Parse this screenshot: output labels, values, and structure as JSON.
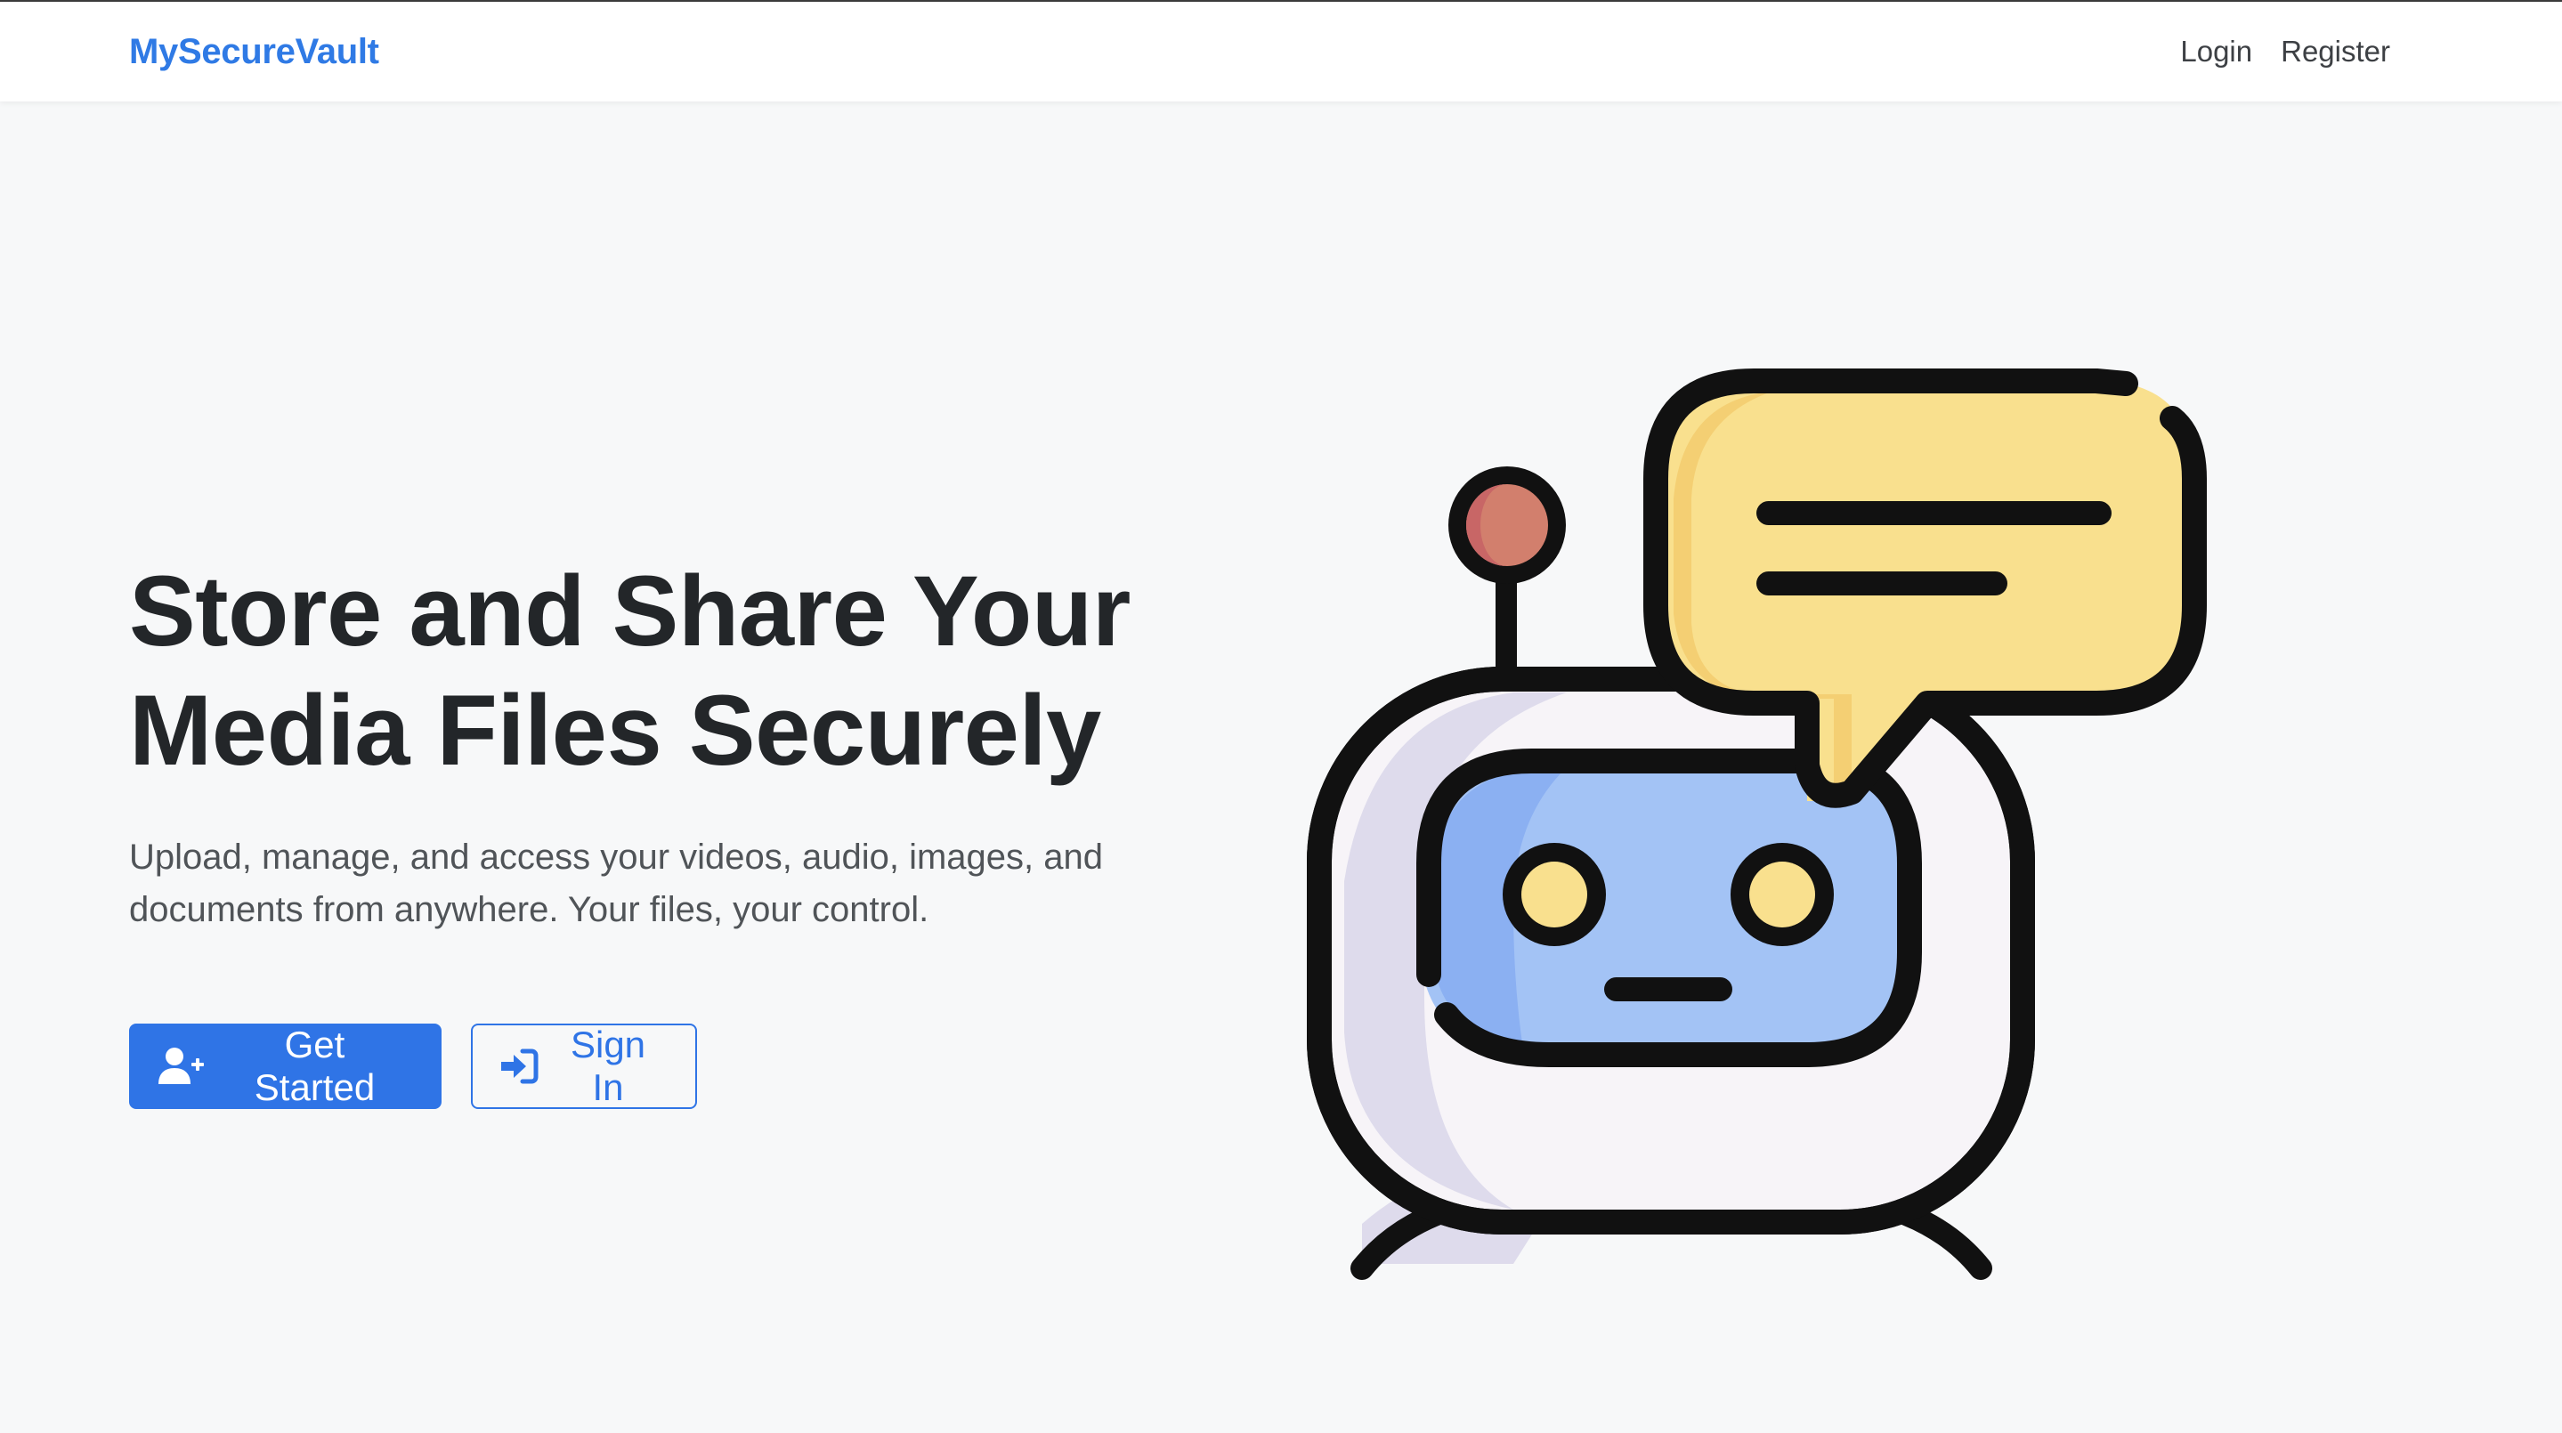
{
  "navbar": {
    "brand": "MySecureVault",
    "links": [
      {
        "label": "Login"
      },
      {
        "label": "Register"
      }
    ]
  },
  "hero": {
    "title_line1": "Store and Share Your",
    "title_line2": "Media Files Securely",
    "subtitle_line1": "Upload, manage, and access your videos, audio, images, and",
    "subtitle_line2": "documents from anywhere. Your files, your control.",
    "primary_button": {
      "label": "Get Started",
      "icon": "user-plus-icon"
    },
    "secondary_button": {
      "label": "Sign In",
      "icon": "sign-in-icon"
    }
  },
  "illustration": {
    "icon": "robot-chat-illustration"
  },
  "colors": {
    "brand": "#2f7ae5",
    "primary": "#2f74e6",
    "background": "#f7f8f9",
    "robot_face": "#a3c3f5",
    "speech_bubble": "#f9e08e",
    "antenna_ball": "#d27f6d"
  }
}
